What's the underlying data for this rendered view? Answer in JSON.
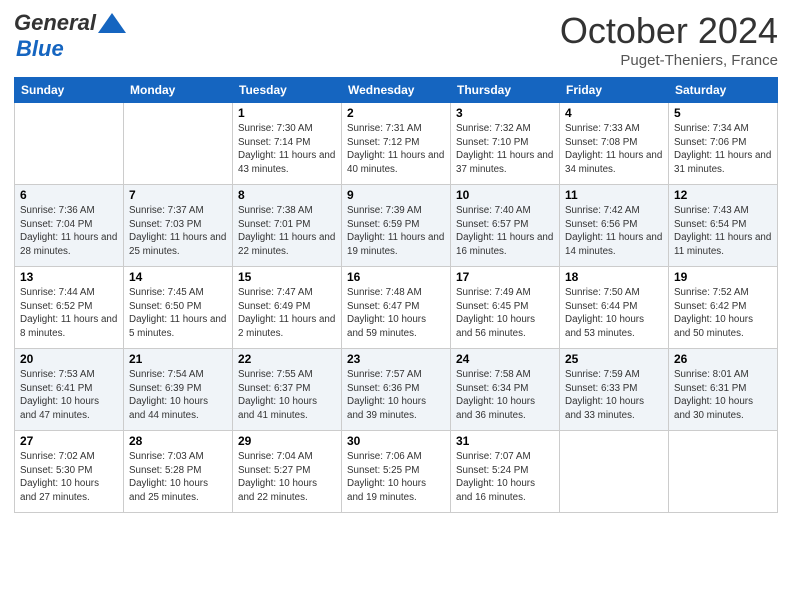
{
  "header": {
    "logo_line1": "General",
    "logo_line2": "Blue",
    "month_title": "October 2024",
    "location": "Puget-Theniers, France"
  },
  "calendar": {
    "days_of_week": [
      "Sunday",
      "Monday",
      "Tuesday",
      "Wednesday",
      "Thursday",
      "Friday",
      "Saturday"
    ],
    "weeks": [
      [
        {
          "day": "",
          "sunrise": "",
          "sunset": "",
          "daylight": ""
        },
        {
          "day": "",
          "sunrise": "",
          "sunset": "",
          "daylight": ""
        },
        {
          "day": "1",
          "sunrise": "Sunrise: 7:30 AM",
          "sunset": "Sunset: 7:14 PM",
          "daylight": "Daylight: 11 hours and 43 minutes."
        },
        {
          "day": "2",
          "sunrise": "Sunrise: 7:31 AM",
          "sunset": "Sunset: 7:12 PM",
          "daylight": "Daylight: 11 hours and 40 minutes."
        },
        {
          "day": "3",
          "sunrise": "Sunrise: 7:32 AM",
          "sunset": "Sunset: 7:10 PM",
          "daylight": "Daylight: 11 hours and 37 minutes."
        },
        {
          "day": "4",
          "sunrise": "Sunrise: 7:33 AM",
          "sunset": "Sunset: 7:08 PM",
          "daylight": "Daylight: 11 hours and 34 minutes."
        },
        {
          "day": "5",
          "sunrise": "Sunrise: 7:34 AM",
          "sunset": "Sunset: 7:06 PM",
          "daylight": "Daylight: 11 hours and 31 minutes."
        }
      ],
      [
        {
          "day": "6",
          "sunrise": "Sunrise: 7:36 AM",
          "sunset": "Sunset: 7:04 PM",
          "daylight": "Daylight: 11 hours and 28 minutes."
        },
        {
          "day": "7",
          "sunrise": "Sunrise: 7:37 AM",
          "sunset": "Sunset: 7:03 PM",
          "daylight": "Daylight: 11 hours and 25 minutes."
        },
        {
          "day": "8",
          "sunrise": "Sunrise: 7:38 AM",
          "sunset": "Sunset: 7:01 PM",
          "daylight": "Daylight: 11 hours and 22 minutes."
        },
        {
          "day": "9",
          "sunrise": "Sunrise: 7:39 AM",
          "sunset": "Sunset: 6:59 PM",
          "daylight": "Daylight: 11 hours and 19 minutes."
        },
        {
          "day": "10",
          "sunrise": "Sunrise: 7:40 AM",
          "sunset": "Sunset: 6:57 PM",
          "daylight": "Daylight: 11 hours and 16 minutes."
        },
        {
          "day": "11",
          "sunrise": "Sunrise: 7:42 AM",
          "sunset": "Sunset: 6:56 PM",
          "daylight": "Daylight: 11 hours and 14 minutes."
        },
        {
          "day": "12",
          "sunrise": "Sunrise: 7:43 AM",
          "sunset": "Sunset: 6:54 PM",
          "daylight": "Daylight: 11 hours and 11 minutes."
        }
      ],
      [
        {
          "day": "13",
          "sunrise": "Sunrise: 7:44 AM",
          "sunset": "Sunset: 6:52 PM",
          "daylight": "Daylight: 11 hours and 8 minutes."
        },
        {
          "day": "14",
          "sunrise": "Sunrise: 7:45 AM",
          "sunset": "Sunset: 6:50 PM",
          "daylight": "Daylight: 11 hours and 5 minutes."
        },
        {
          "day": "15",
          "sunrise": "Sunrise: 7:47 AM",
          "sunset": "Sunset: 6:49 PM",
          "daylight": "Daylight: 11 hours and 2 minutes."
        },
        {
          "day": "16",
          "sunrise": "Sunrise: 7:48 AM",
          "sunset": "Sunset: 6:47 PM",
          "daylight": "Daylight: 10 hours and 59 minutes."
        },
        {
          "day": "17",
          "sunrise": "Sunrise: 7:49 AM",
          "sunset": "Sunset: 6:45 PM",
          "daylight": "Daylight: 10 hours and 56 minutes."
        },
        {
          "day": "18",
          "sunrise": "Sunrise: 7:50 AM",
          "sunset": "Sunset: 6:44 PM",
          "daylight": "Daylight: 10 hours and 53 minutes."
        },
        {
          "day": "19",
          "sunrise": "Sunrise: 7:52 AM",
          "sunset": "Sunset: 6:42 PM",
          "daylight": "Daylight: 10 hours and 50 minutes."
        }
      ],
      [
        {
          "day": "20",
          "sunrise": "Sunrise: 7:53 AM",
          "sunset": "Sunset: 6:41 PM",
          "daylight": "Daylight: 10 hours and 47 minutes."
        },
        {
          "day": "21",
          "sunrise": "Sunrise: 7:54 AM",
          "sunset": "Sunset: 6:39 PM",
          "daylight": "Daylight: 10 hours and 44 minutes."
        },
        {
          "day": "22",
          "sunrise": "Sunrise: 7:55 AM",
          "sunset": "Sunset: 6:37 PM",
          "daylight": "Daylight: 10 hours and 41 minutes."
        },
        {
          "day": "23",
          "sunrise": "Sunrise: 7:57 AM",
          "sunset": "Sunset: 6:36 PM",
          "daylight": "Daylight: 10 hours and 39 minutes."
        },
        {
          "day": "24",
          "sunrise": "Sunrise: 7:58 AM",
          "sunset": "Sunset: 6:34 PM",
          "daylight": "Daylight: 10 hours and 36 minutes."
        },
        {
          "day": "25",
          "sunrise": "Sunrise: 7:59 AM",
          "sunset": "Sunset: 6:33 PM",
          "daylight": "Daylight: 10 hours and 33 minutes."
        },
        {
          "day": "26",
          "sunrise": "Sunrise: 8:01 AM",
          "sunset": "Sunset: 6:31 PM",
          "daylight": "Daylight: 10 hours and 30 minutes."
        }
      ],
      [
        {
          "day": "27",
          "sunrise": "Sunrise: 7:02 AM",
          "sunset": "Sunset: 5:30 PM",
          "daylight": "Daylight: 10 hours and 27 minutes."
        },
        {
          "day": "28",
          "sunrise": "Sunrise: 7:03 AM",
          "sunset": "Sunset: 5:28 PM",
          "daylight": "Daylight: 10 hours and 25 minutes."
        },
        {
          "day": "29",
          "sunrise": "Sunrise: 7:04 AM",
          "sunset": "Sunset: 5:27 PM",
          "daylight": "Daylight: 10 hours and 22 minutes."
        },
        {
          "day": "30",
          "sunrise": "Sunrise: 7:06 AM",
          "sunset": "Sunset: 5:25 PM",
          "daylight": "Daylight: 10 hours and 19 minutes."
        },
        {
          "day": "31",
          "sunrise": "Sunrise: 7:07 AM",
          "sunset": "Sunset: 5:24 PM",
          "daylight": "Daylight: 10 hours and 16 minutes."
        },
        {
          "day": "",
          "sunrise": "",
          "sunset": "",
          "daylight": ""
        },
        {
          "day": "",
          "sunrise": "",
          "sunset": "",
          "daylight": ""
        }
      ]
    ]
  }
}
